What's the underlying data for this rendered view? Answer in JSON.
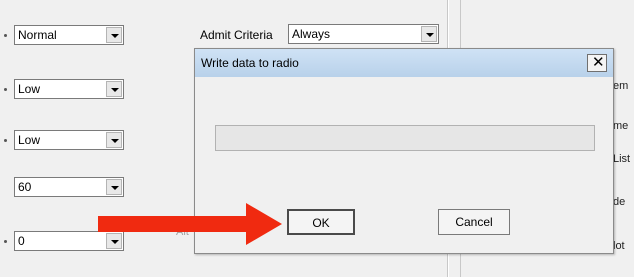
{
  "form": {
    "combos": [
      {
        "value": "Normal"
      },
      {
        "value": "Low"
      },
      {
        "value": "Low"
      },
      {
        "value": "60"
      },
      {
        "value": "0"
      }
    ],
    "admit_criteria_label": "Admit Criteria",
    "admit_criteria_value": "Always",
    "faded_label": "Alt",
    "right_fragments": [
      "em",
      "me",
      "List",
      "de",
      "lot"
    ]
  },
  "dialog": {
    "title": "Write data to radio",
    "close_glyph": "✕",
    "progress": 0,
    "ok_label": "OK",
    "cancel_label": "Cancel"
  },
  "colors": {
    "title_bar": "#b8d1ea",
    "annotation_arrow": "#f02a10"
  },
  "icons": [
    "chevron-down-icon",
    "close-icon",
    "red-arrow-annotation"
  ]
}
